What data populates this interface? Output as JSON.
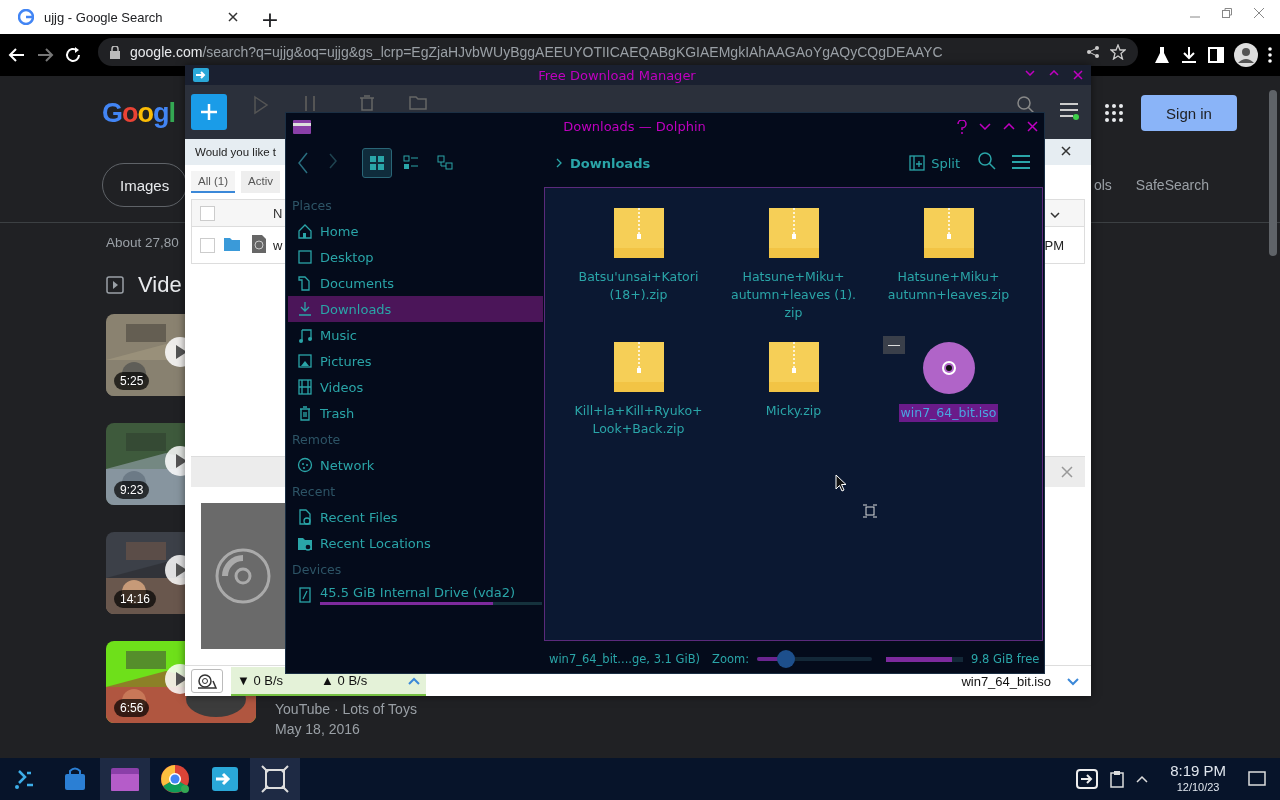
{
  "browser": {
    "tab_title": "ujjg - Google Search",
    "new_tab": "+",
    "url_host": "google.com",
    "url_path": "/search?q=ujjg&oq=ujjg&gs_lcrp=EgZjaHJvbWUyBggAEEUYOTIICAEQABgKGIAEMgkIAhAAGAoYgAQyCQgDEAAYC"
  },
  "google": {
    "logo": "Googl",
    "sign_in": "Sign in",
    "filters": [
      "Images"
    ],
    "right_filters": [
      "ols",
      "SafeSearch"
    ],
    "result_count": "About 27,80",
    "videos_heading": "Vide",
    "videos": [
      {
        "kind": "picture",
        "duration": "5:25"
      },
      {
        "kind": "picture",
        "duration": "9:23"
      },
      {
        "kind": "picture",
        "duration": "14:16"
      },
      {
        "kind": "picture",
        "duration": "6:56",
        "source": "YouTube · Lots of Toys",
        "date": "May 18, 2016"
      }
    ]
  },
  "fdm": {
    "title": "Free Download Manager",
    "banner": "Would you like t",
    "tabs": [
      {
        "label": "All (1)",
        "selected": true
      },
      {
        "label": "Activ",
        "selected": false
      }
    ],
    "header_checked": false,
    "row_checked": false,
    "column_1": "N",
    "row_name": "w",
    "row_time": "PM",
    "down_speed": "▼ 0 B/s",
    "up_speed": "▲ 0 B/s",
    "selected_file": "win7_64_bit.iso"
  },
  "dolphin": {
    "title": "Downloads — Dolphin",
    "view_modes": [
      {
        "kind": "icons",
        "selected": true
      },
      {
        "kind": "compact",
        "selected": false
      },
      {
        "kind": "tree",
        "selected": false
      }
    ],
    "breadcrumb": "Downloads",
    "split": "Split",
    "sections": [
      {
        "title": "Places",
        "items": [
          {
            "label": "Home",
            "kind": "home",
            "selected": false
          },
          {
            "label": "Desktop",
            "kind": "desktop",
            "selected": false
          },
          {
            "label": "Documents",
            "kind": "documents",
            "selected": false
          },
          {
            "label": "Downloads",
            "kind": "downloads",
            "selected": true
          },
          {
            "label": "Music",
            "kind": "music",
            "selected": false
          },
          {
            "label": "Pictures",
            "kind": "pictures",
            "selected": false
          },
          {
            "label": "Videos",
            "kind": "videos",
            "selected": false
          },
          {
            "label": "Trash",
            "kind": "trash",
            "selected": false
          }
        ]
      },
      {
        "title": "Remote",
        "items": [
          {
            "label": "Network",
            "kind": "network",
            "selected": false
          }
        ]
      },
      {
        "title": "Recent",
        "items": [
          {
            "label": "Recent Files",
            "kind": "recent-files",
            "selected": false
          },
          {
            "label": "Recent Locations",
            "kind": "recent-locations",
            "selected": false
          }
        ]
      },
      {
        "title": "Devices",
        "items": [
          {
            "label": "45.5 GiB Internal Drive (vda2)",
            "kind": "drive",
            "selected": false,
            "level": 0.78
          }
        ]
      }
    ],
    "files": [
      {
        "name": "Batsu'unsai+Katori (18+).zip",
        "kind": "zip",
        "selected": false
      },
      {
        "name": "Hatsune+Miku+ autumn+leaves (1). zip",
        "kind": "zip",
        "selected": false
      },
      {
        "name": "Hatsune+Miku+ autumn+leaves.zip",
        "kind": "zip",
        "selected": false
      },
      {
        "name": "Kill+la+Kill+Ryuko+ Look+Back.zip",
        "kind": "zip",
        "selected": false
      },
      {
        "name": "Micky.zip",
        "kind": "zip",
        "selected": false
      },
      {
        "name": "win7_64_bit.iso",
        "kind": "iso",
        "selected": true
      }
    ],
    "status": "win7_64_bit....ge, 3.1 GiB)",
    "zoom_label": "Zoom:",
    "zoom": {
      "level": 0.25
    },
    "free_space": {
      "level": 0.85
    },
    "free_label": "9.8 GiB free"
  },
  "taskbar": {
    "apps": [
      {
        "kind": "launcher",
        "selected": false
      },
      {
        "kind": "store",
        "selected": false
      },
      {
        "kind": "files",
        "selected": true
      },
      {
        "kind": "chrome",
        "selected": false
      },
      {
        "kind": "fdm",
        "selected": false
      },
      {
        "kind": "capture",
        "selected": true
      }
    ],
    "time": "8:19 PM",
    "date": "12/10/23"
  }
}
